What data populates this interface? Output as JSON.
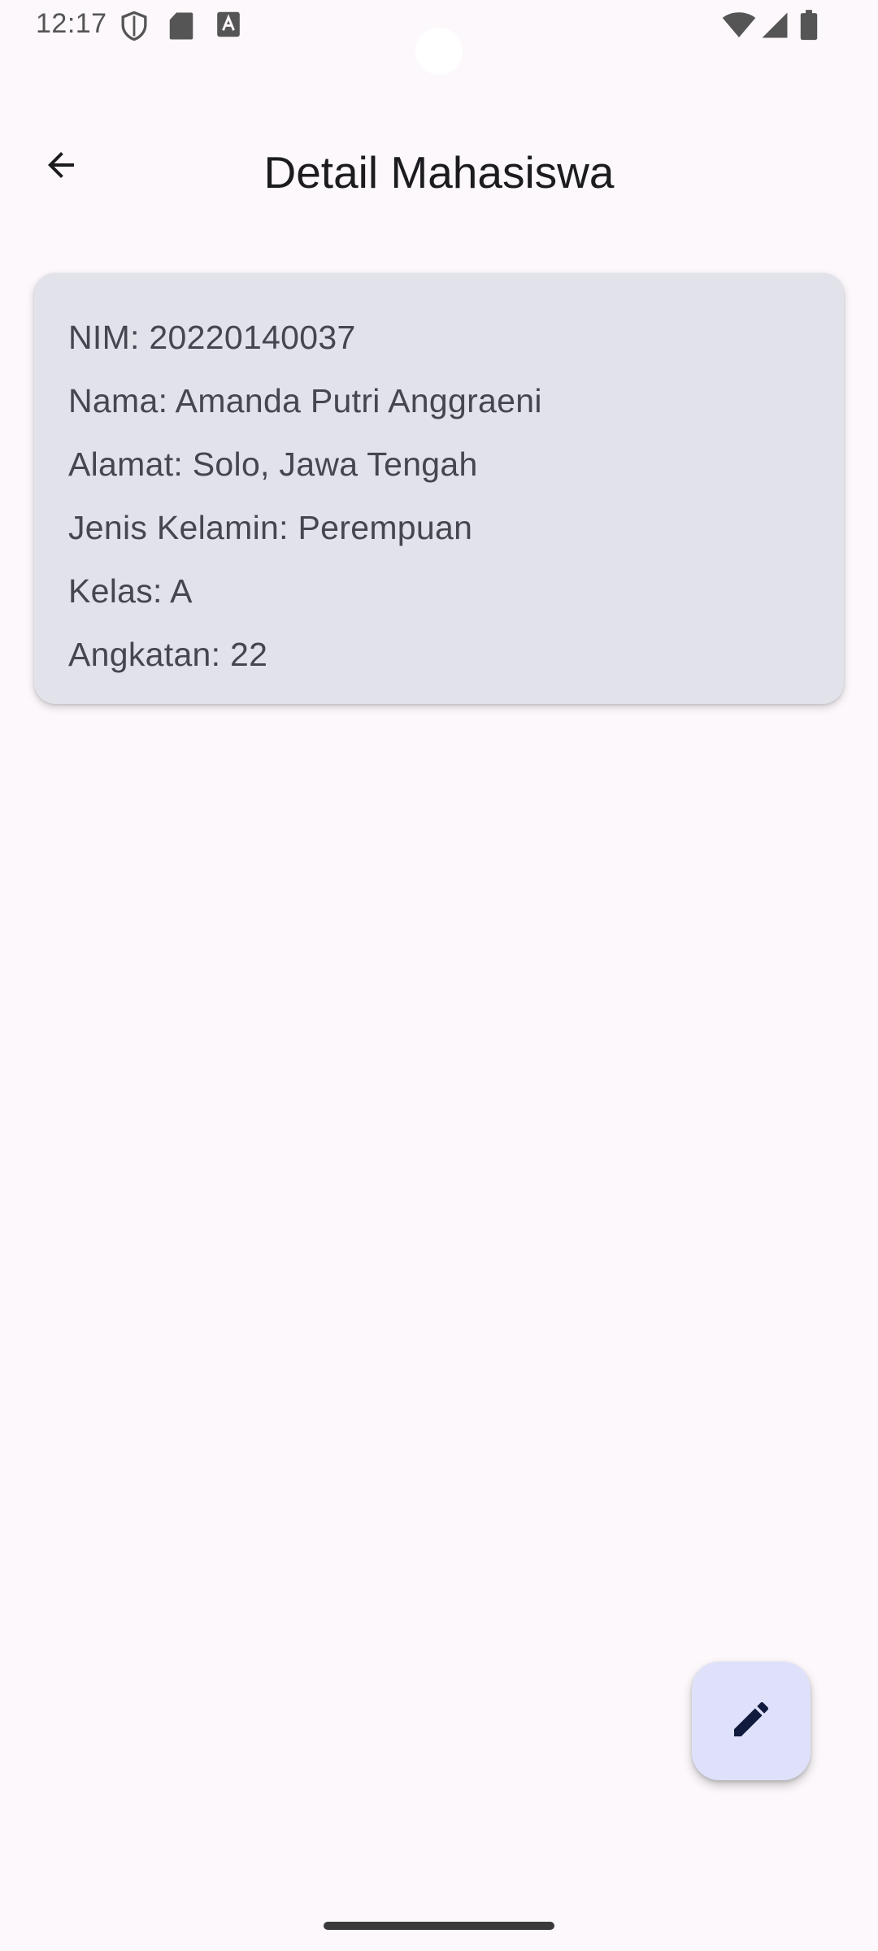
{
  "status_bar": {
    "time": "12:17",
    "left_icons": [
      "shield-icon",
      "sd-card-icon",
      "keyboard-a-icon"
    ],
    "right_icons": [
      "wifi-icon",
      "signal-icon",
      "battery-icon"
    ]
  },
  "top_bar": {
    "title": "Detail Mahasiswa",
    "back_icon": "arrow-back-icon"
  },
  "student": {
    "nim": "NIM: 20220140037",
    "nama": "Nama: Amanda Putri Anggraeni",
    "alamat": "Alamat: Solo, Jawa Tengah",
    "jenis_kelamin": "Jenis Kelamin: Perempuan",
    "kelas": "Kelas: A",
    "angkatan": "Angkatan: 22"
  },
  "fab": {
    "icon": "edit-pencil-icon",
    "background_color": "#DEE1F9",
    "icon_color": "#0F1A3D"
  },
  "colors": {
    "background": "#FCF8FB",
    "card": "#E2E2EA",
    "card_text": "#45464F"
  }
}
